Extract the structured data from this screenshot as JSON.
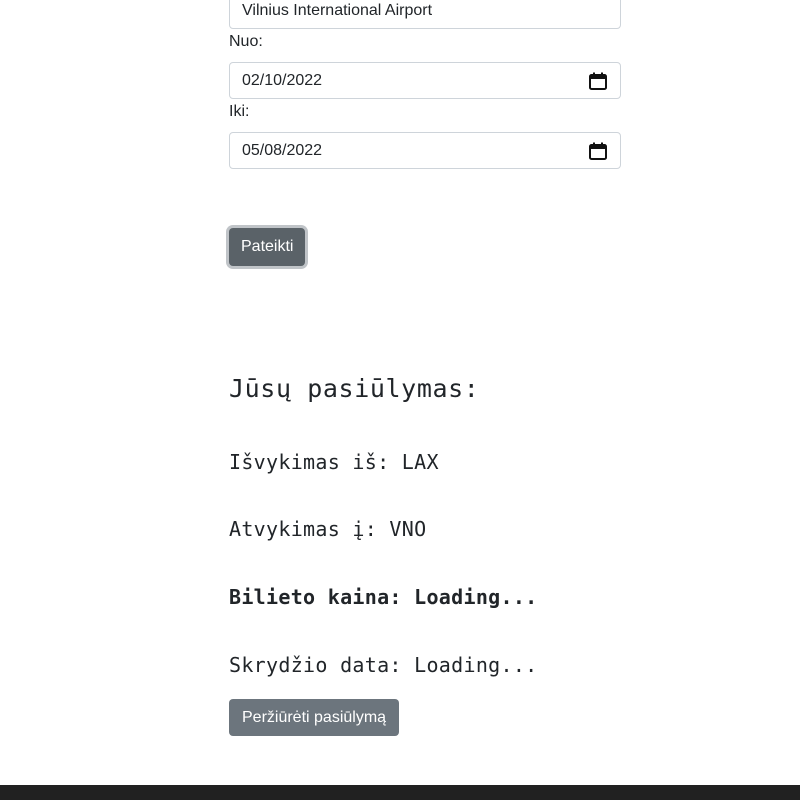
{
  "form": {
    "airport_value": "Vilnius International Airport",
    "from_label": "Nuo:",
    "from_value": "02/10/2022",
    "to_label": "Iki:",
    "to_value": "05/08/2022",
    "submit_label": "Pateikti",
    "calendar_icon": "calendar-icon"
  },
  "offer": {
    "title": "Jūsų pasiūlymas:",
    "departure": "Išvykimas iš: LAX",
    "arrival": "Atvykimas į: VNO",
    "price": "Bilieto kaina: Loading...",
    "date": "Skrydžio data: Loading...",
    "view_button_label": "Peržiūrėti pasiūlymą"
  },
  "colors": {
    "submit_button": "#5a6268",
    "view_button": "#6c757d",
    "footer": "#212121"
  }
}
